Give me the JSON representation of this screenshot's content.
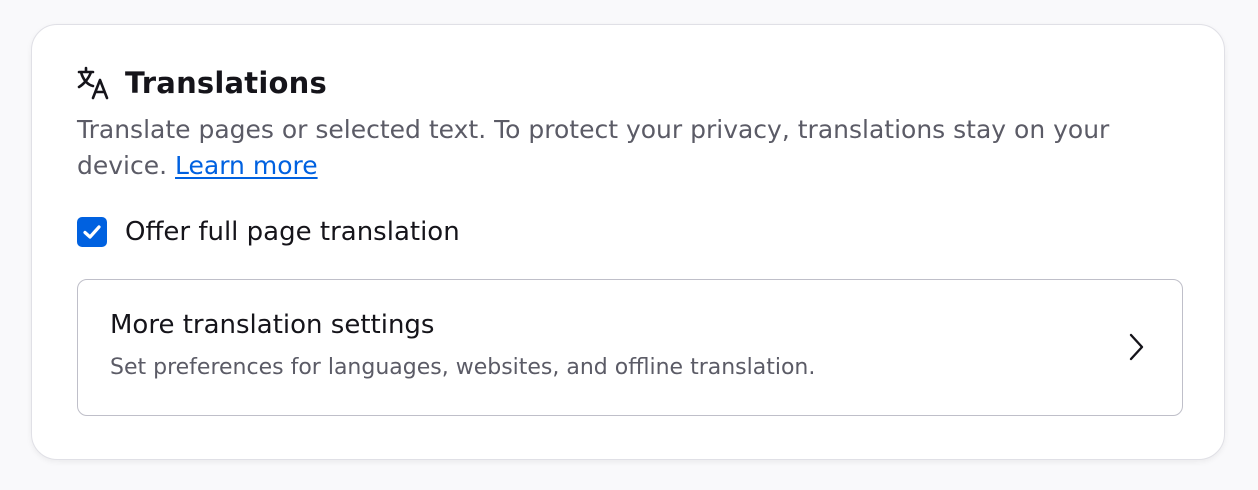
{
  "section": {
    "title": "Translations",
    "icon": "translate-icon",
    "description": "Translate pages or selected text. To protect your privacy, translations stay on your device.",
    "learn_more": "Learn more"
  },
  "full_page": {
    "label": "Offer full page translation",
    "checked": true
  },
  "more_settings": {
    "title": "More translation settings",
    "subtitle": "Set preferences for languages, websites, and offline translation.",
    "icon": "chevron-right-icon"
  },
  "colors": {
    "accent": "#0061e0",
    "text": "#15141a",
    "secondary_text": "#5b5b66",
    "border": "#bfbfc9"
  }
}
